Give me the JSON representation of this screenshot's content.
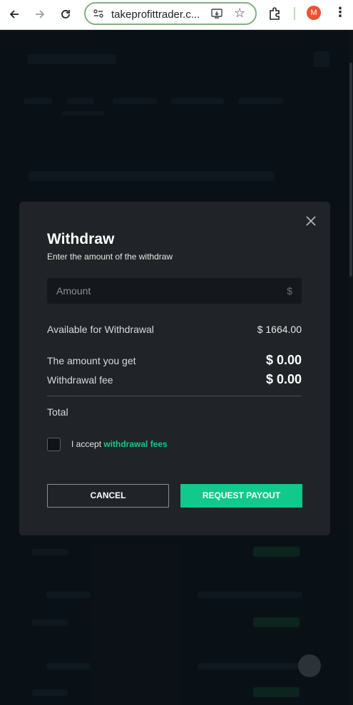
{
  "browser": {
    "url": "takeprofittrader.c...",
    "profile_initial": "M",
    "accent_profile": "#e8542f"
  },
  "modal": {
    "title": "Withdraw",
    "subtitle": "Enter the amount of the withdraw",
    "amount_placeholder": "Amount",
    "currency_symbol": "$",
    "available_label": "Available for Withdrawal",
    "available_value": "$ 1664.00",
    "amount_you_get_label": "The amount you get",
    "amount_you_get_value": "$ 0.00",
    "fee_label": "Withdrawal fee",
    "fee_value": "$ 0.00",
    "total_label": "Total",
    "accept_text": "I accept ",
    "accept_link": "withdrawal fees",
    "cancel_label": "CANCEL",
    "payout_label": "REQUEST PAYOUT",
    "accent_green": "#10c98a"
  }
}
